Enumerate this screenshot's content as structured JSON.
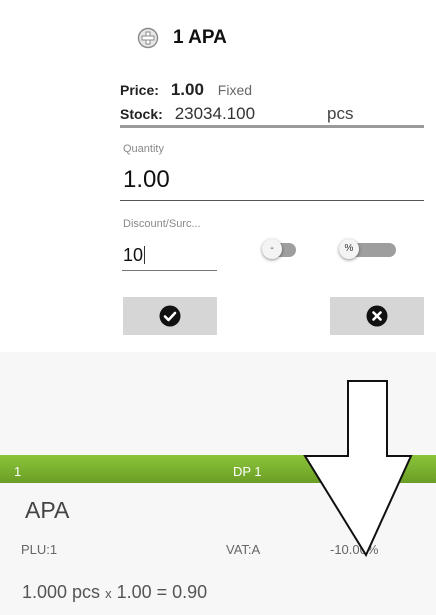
{
  "dialog": {
    "title": "1 APA",
    "price_label": "Price:",
    "price_value": "1.00",
    "price_mode": "Fixed",
    "stock_label": "Stock:",
    "stock_value": "23034.100",
    "stock_unit": "pcs",
    "quantity_label": "Quantity",
    "quantity_value": "1.00",
    "discount_label": "Discount/Surc...",
    "discount_value": "10",
    "toggle_minus_label": "-",
    "toggle_percent_label": "%",
    "confirm_icon": "check-circle-icon",
    "cancel_icon": "close-circle-icon"
  },
  "receipt": {
    "line_number": "1",
    "department": "DP 1",
    "item_name": "APA",
    "plu": "PLU:1",
    "vat": "VAT:A",
    "discount": "-10.00%",
    "qty_part": "1.000 pcs",
    "times": "x",
    "price_total": "1.00 = 0.90"
  },
  "colors": {
    "accent_green": "#7bb22f",
    "button_gray": "#d6d6d6"
  }
}
